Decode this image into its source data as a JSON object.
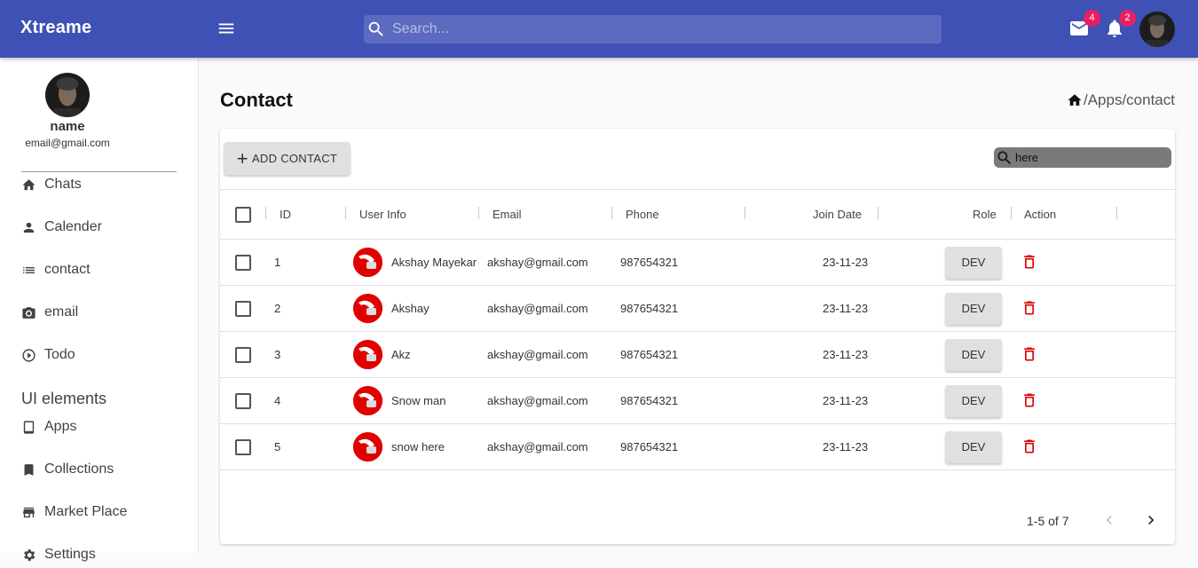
{
  "colors": {
    "primary": "#3f51b5",
    "badge": "#e91e63",
    "delete": "#e00000"
  },
  "appbar": {
    "brand": "Xtreame",
    "search_placeholder": "Search...",
    "mail_badge": "4",
    "notif_badge": "2"
  },
  "sidebar": {
    "name": "name",
    "email": "email@gmail.com",
    "items": [
      {
        "label": "Chats",
        "icon": "home-icon"
      },
      {
        "label": "Calender",
        "icon": "person-icon"
      },
      {
        "label": "contact",
        "icon": "list-icon"
      },
      {
        "label": "email",
        "icon": "camera-icon"
      },
      {
        "label": "Todo",
        "icon": "play-circle-icon"
      }
    ],
    "section_title": "UI elements",
    "section_items": [
      {
        "label": "Apps",
        "icon": "tablet-icon"
      },
      {
        "label": "Collections",
        "icon": "bookmark-icon"
      },
      {
        "label": "Market Place",
        "icon": "store-icon"
      },
      {
        "label": "Settings",
        "icon": "gear-icon"
      }
    ]
  },
  "page": {
    "title": "Contact",
    "breadcrumb": "/Apps/contact"
  },
  "toolbar": {
    "add_label": "ADD CONTACT",
    "search_placeholder": "here"
  },
  "table": {
    "headers": {
      "id": "ID",
      "user": "User Info",
      "email": "Email",
      "phone": "Phone",
      "join": "Join Date",
      "role": "Role",
      "action": "Action"
    },
    "rows": [
      {
        "id": "1",
        "name": "Akshay Mayekar",
        "email": "akshay@gmail.com",
        "phone": "987654321",
        "join": "23-11-23",
        "role": "DEV"
      },
      {
        "id": "2",
        "name": "Akshay",
        "email": "akshay@gmail.com",
        "phone": "987654321",
        "join": "23-11-23",
        "role": "DEV"
      },
      {
        "id": "3",
        "name": "Akz",
        "email": "akshay@gmail.com",
        "phone": "987654321",
        "join": "23-11-23",
        "role": "DEV"
      },
      {
        "id": "4",
        "name": "Snow man",
        "email": "akshay@gmail.com",
        "phone": "987654321",
        "join": "23-11-23",
        "role": "DEV"
      },
      {
        "id": "5",
        "name": "snow here",
        "email": "akshay@gmail.com",
        "phone": "987654321",
        "join": "23-11-23",
        "role": "DEV"
      }
    ],
    "pagination": "1-5 of 7"
  }
}
